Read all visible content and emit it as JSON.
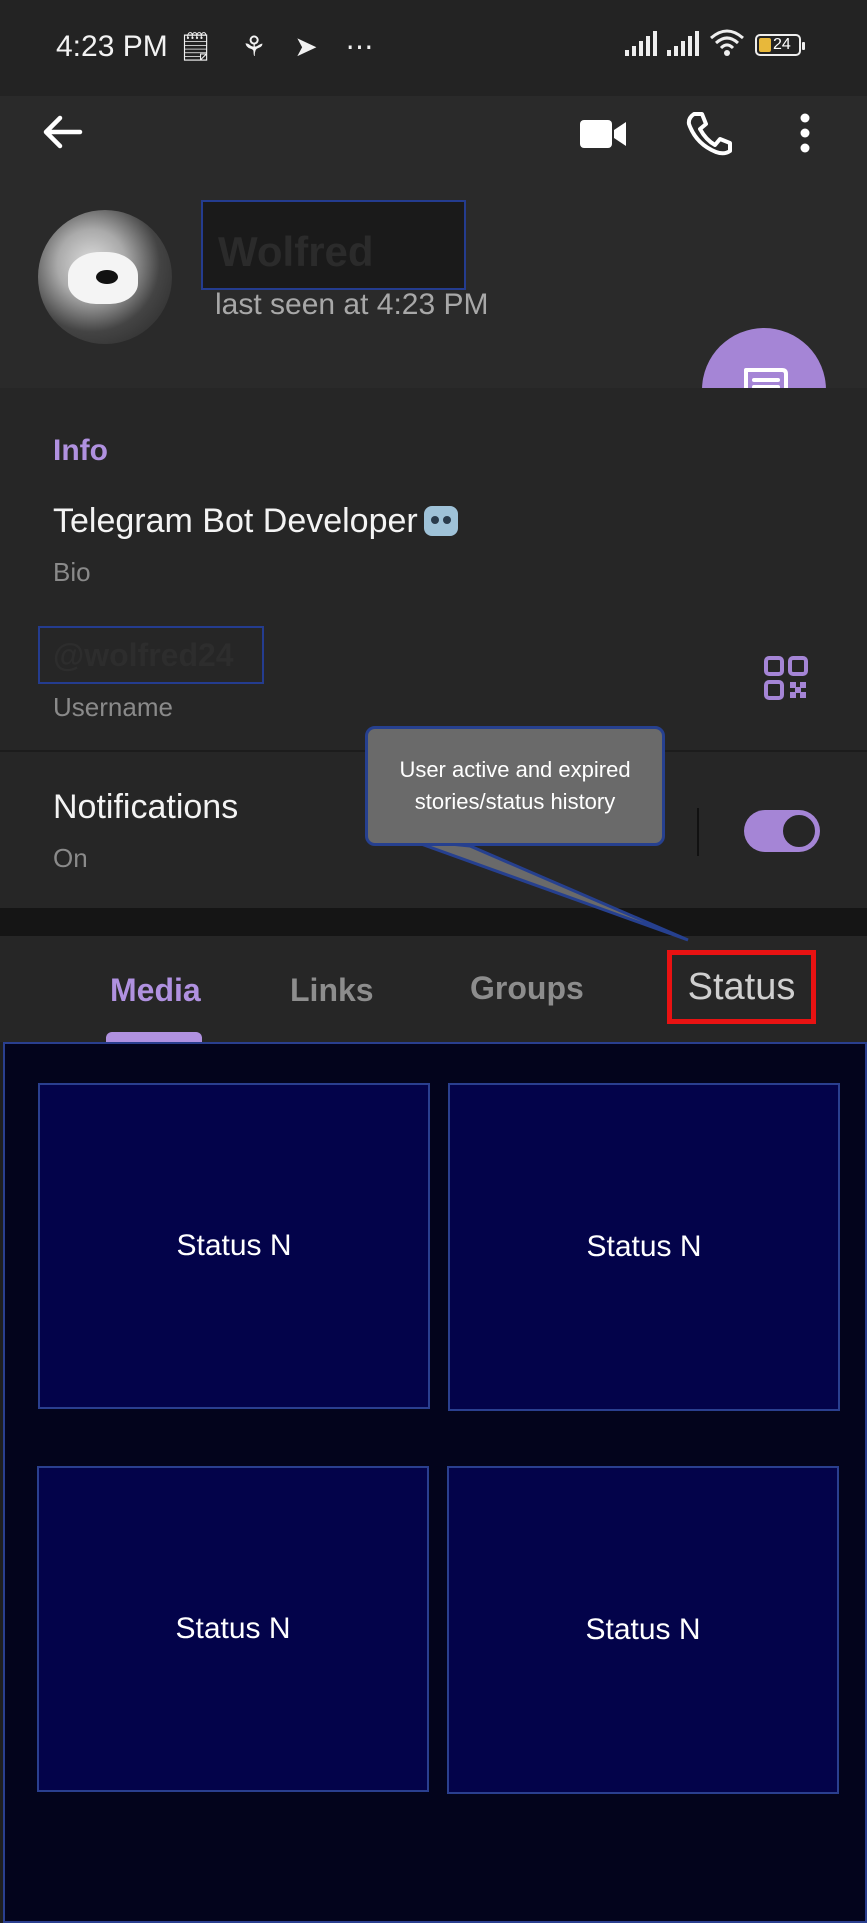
{
  "status_bar": {
    "time": "4:23 PM",
    "left_icons": "🗒 ⚘ ➤ ⋯",
    "battery": "24",
    "icons": [
      "notes-icon",
      "missed-call-icon",
      "telegram-icon",
      "more-dots-icon",
      "signal-icon",
      "signal-icon",
      "wifi-icon",
      "battery-icon"
    ]
  },
  "header": {
    "name": "Wolfred",
    "last_seen": "last seen at 4:23 PM",
    "icons": [
      "back-arrow-icon",
      "video-call-icon",
      "phone-icon",
      "more-vert-icon",
      "message-icon"
    ]
  },
  "info": {
    "section_title": "Info",
    "bio": "Telegram Bot Developer",
    "bio_label": "Bio",
    "username": "@wolfred24",
    "username_label": "Username",
    "notifications_label": "Notifications",
    "notifications_value": "On",
    "notifications_enabled": true
  },
  "tabs": {
    "items": [
      "Media",
      "Links",
      "Groups",
      "Status"
    ],
    "active": "Media"
  },
  "annotation": {
    "tooltip": "User active and expired stories/status history"
  },
  "status_grid": {
    "cells": [
      "Status N",
      "Status N",
      "Status N",
      "Status N"
    ]
  },
  "colors": {
    "accent": "#b091e0",
    "highlight_border": "#e81212",
    "grid_background": "#03041c",
    "cell_background": "#03034a"
  }
}
